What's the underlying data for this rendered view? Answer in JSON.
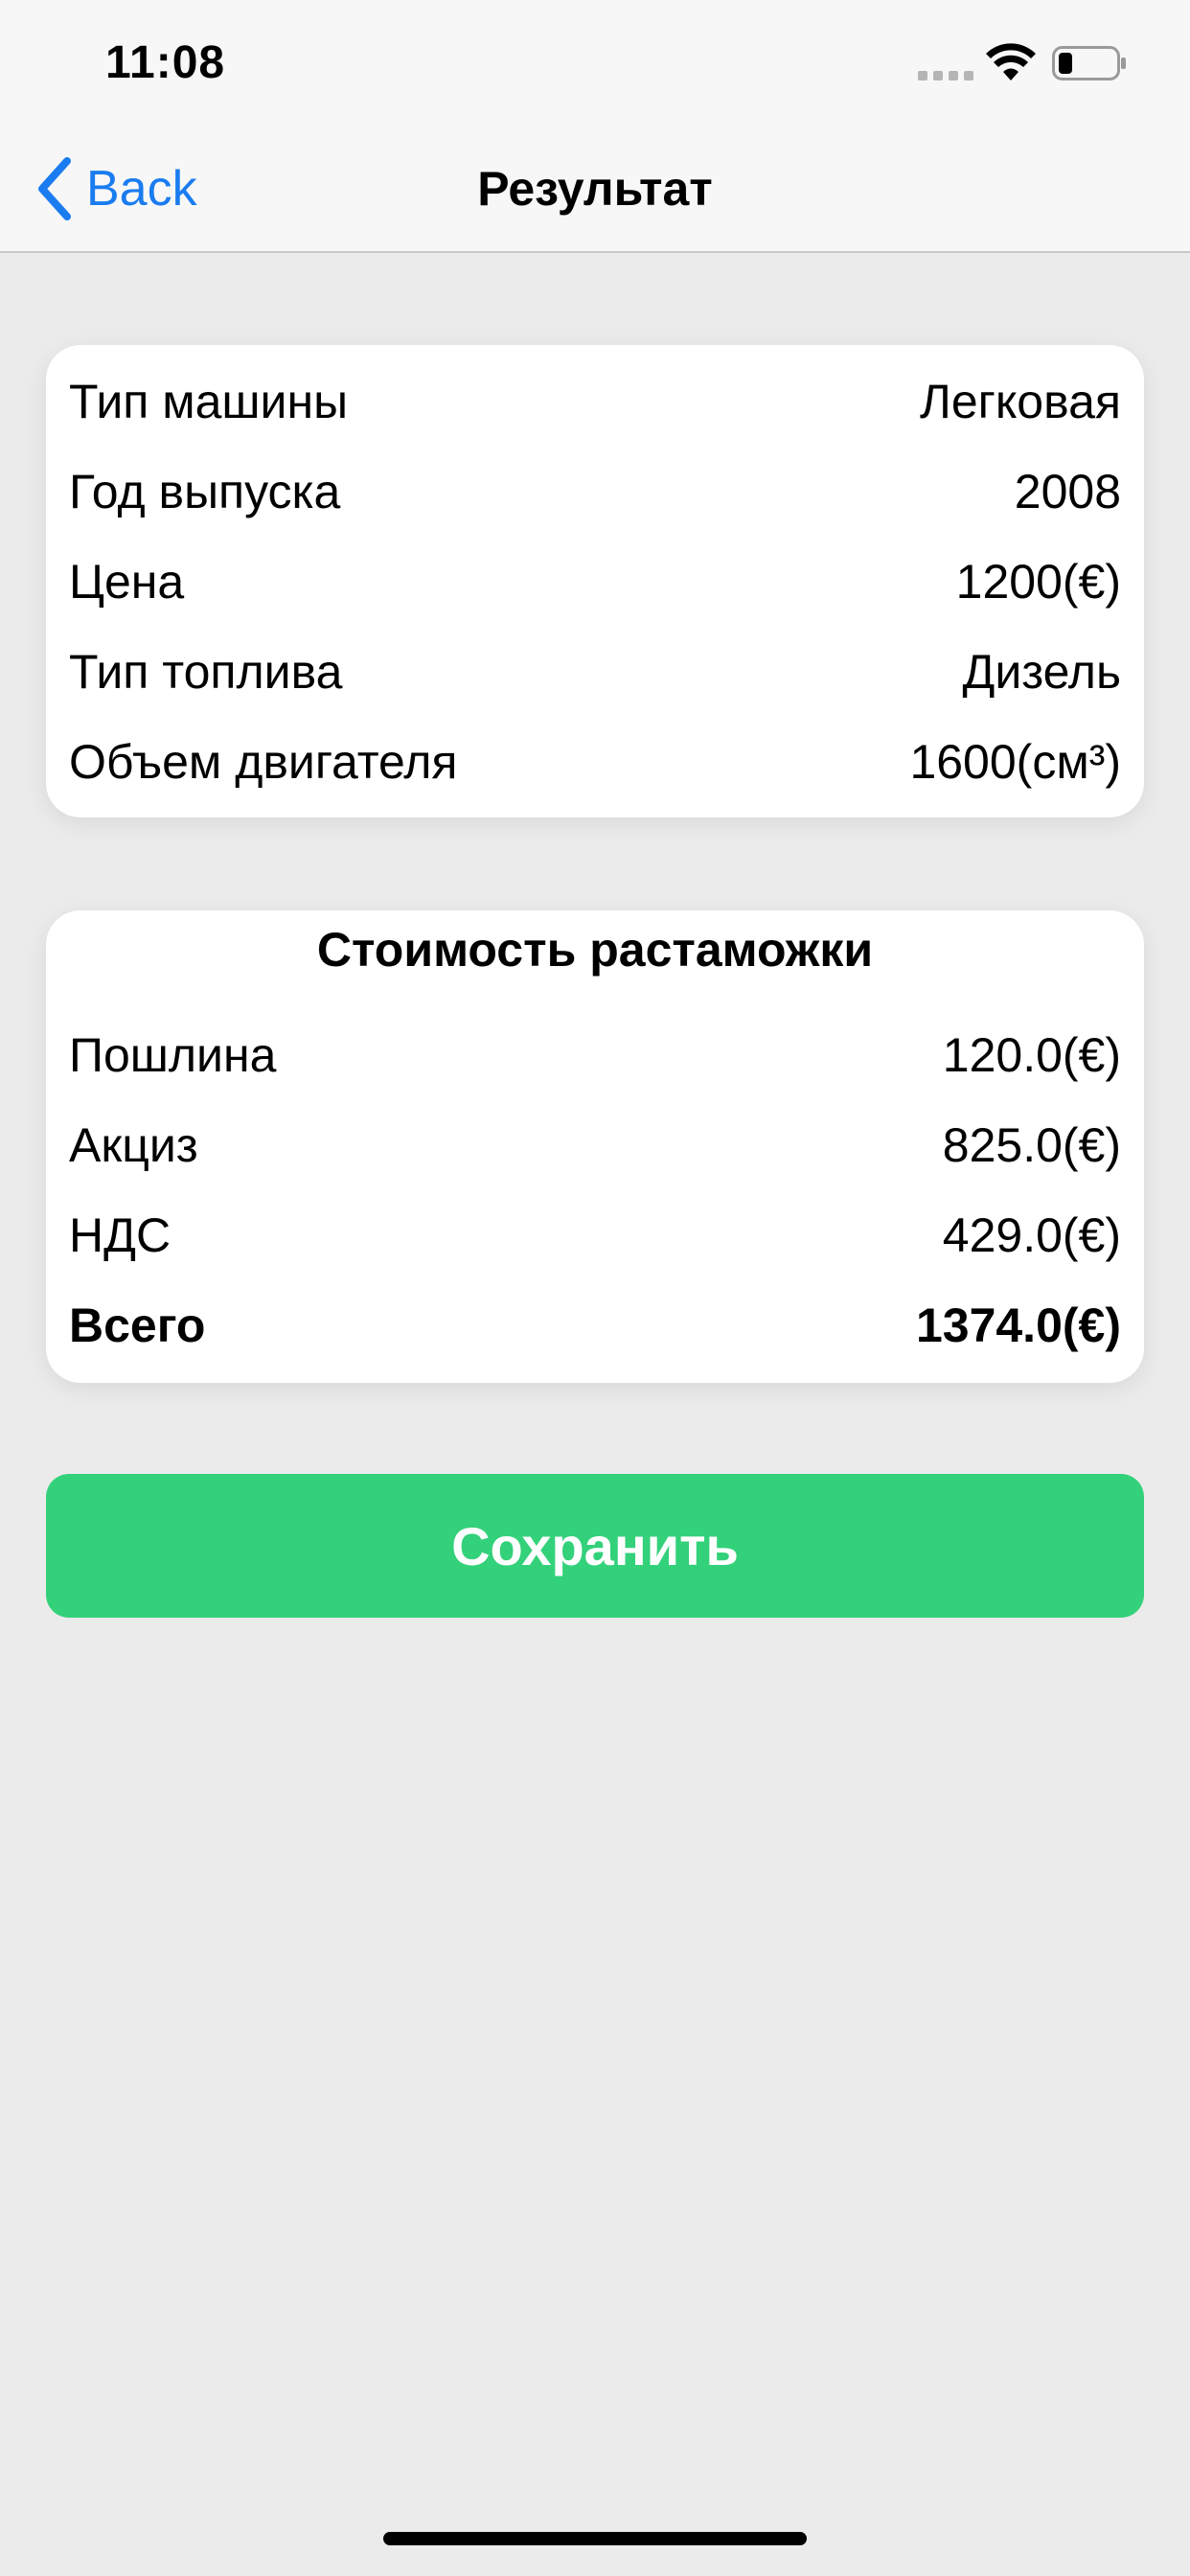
{
  "status_bar": {
    "time": "11:08"
  },
  "nav": {
    "back_label": "Back",
    "title": "Результат"
  },
  "car_info": {
    "rows": [
      {
        "label": "Тип машины",
        "value": "Легковая"
      },
      {
        "label": "Год выпуска",
        "value": "2008"
      },
      {
        "label": "Цена",
        "value": "1200(€)"
      },
      {
        "label": "Тип топлива",
        "value": "Дизель"
      },
      {
        "label": "Объем двигателя",
        "value": "1600(см³)"
      }
    ]
  },
  "customs_cost": {
    "heading": "Стоимость растаможки",
    "rows": [
      {
        "label": "Пошлина",
        "value": "120.0(€)"
      },
      {
        "label": "Акциз",
        "value": "825.0(€)"
      },
      {
        "label": "НДС",
        "value": "429.0(€)"
      }
    ],
    "total": {
      "label": "Всего",
      "value": "1374.0(€)"
    }
  },
  "actions": {
    "save_label": "Сохранить"
  },
  "colors": {
    "accent_blue": "#1a7cf0",
    "save_green": "#33d17a",
    "background": "#ebebeb"
  },
  "icons": {
    "back": "chevron-left-icon",
    "wifi": "wifi-icon",
    "battery": "battery-icon",
    "signal": "signal-dots-icon"
  }
}
